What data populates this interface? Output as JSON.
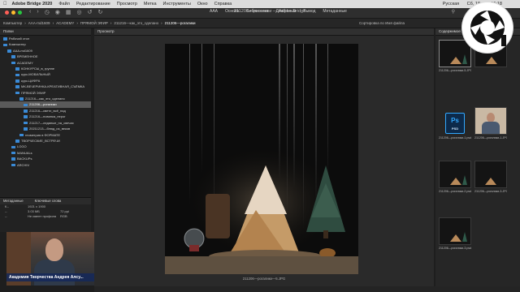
{
  "menubar": {
    "app": "Adobe Bridge 2020",
    "items": [
      "Файл",
      "Редактирование",
      "Просмотр",
      "Метка",
      "Инструменты",
      "Окно",
      "Справка"
    ],
    "clock": "Сб, 18 дек. 16:18",
    "keyboard": "Русская"
  },
  "window": {
    "title": "211206—рогалики — Adobe Bridge",
    "workspaces": [
      "AAA",
      "Основн",
      "Библиотеки",
      "Диафильм",
      "Вывод",
      "Метаданные"
    ]
  },
  "path": {
    "crumbs": [
      "Компьютер",
      "AAA-md1609",
      "ACADEMY",
      "ПРЯМОЙ ЭФИР",
      "211216—как_это_сделано",
      "211206—рогалики"
    ],
    "sort": "Сортировка по Имя файла"
  },
  "folders": {
    "title": "Папки",
    "items": [
      {
        "label": "Рабочий стол",
        "depth": 0
      },
      {
        "label": "Компьютер",
        "depth": 0
      },
      {
        "label": "AAA-md1609",
        "depth": 1
      },
      {
        "label": "ВРЕМЕННОЕ",
        "depth": 2
      },
      {
        "label": "ACADEMY",
        "depth": 2
      },
      {
        "label": "КОНКУРСЫ_в_группе",
        "depth": 3
      },
      {
        "label": "курс-МОБИЛЬНЫЙ",
        "depth": 3
      },
      {
        "label": "курс-ЦИФРА",
        "depth": 3
      },
      {
        "label": "МК-ВЕЧЕРИНКА-КРЕАТИВНАЯ_СЪЁМКА",
        "depth": 3
      },
      {
        "label": "ПРЯМОЙ ЭФИР",
        "depth": 3
      },
      {
        "label": "211216—как_это_сделано",
        "depth": 4
      },
      {
        "label": "211206—рогалики",
        "depth": 5,
        "selected": true
      },
      {
        "label": "211216—светл_всё_над",
        "depth": 5
      },
      {
        "label": "211216—новинка_перог",
        "depth": 5
      },
      {
        "label": "211217—ледяные_на_свечах",
        "depth": 5
      },
      {
        "label": "20211213—блюд_из_веков",
        "depth": 5
      },
      {
        "label": "геометрия в ФОРМАТЕ",
        "depth": 4
      },
      {
        "label": "ТВОРЧЕСКИЕ_ВСТРЕЧИ",
        "depth": 3
      },
      {
        "label": "LOGO",
        "depth": 2
      },
      {
        "label": "MANUALs",
        "depth": 2
      },
      {
        "label": "BACKUPs",
        "depth": 2
      },
      {
        "label": "ARCHIV",
        "depth": 2
      }
    ]
  },
  "metadata": {
    "tabs": [
      "Метаданные",
      "Ключевые слова"
    ],
    "rows": [
      {
        "k": "f/--",
        "v": "1921 x 1900"
      },
      {
        "k": "--",
        "v": "3.03 МБ",
        "v2": "72 ppi"
      },
      {
        "k": "--",
        "v": "Не имеет профиля",
        "v2": "RGB"
      }
    ]
  },
  "webcam": {
    "caption": "Академия Творчества Андрея Алсу..."
  },
  "preview": {
    "title": "Просмотр",
    "filename": "211206—рогалики—5.JPG"
  },
  "content": {
    "title": "Содержимое",
    "thumbs": [
      {
        "label": "211206—рогалики-5.JPG",
        "kind": "photo",
        "selected": true
      },
      {
        "label": "",
        "kind": "photo"
      },
      {
        "label": "211206—рогалики-1.psd",
        "kind": "psd"
      },
      {
        "label": "211206—рогалики-1.JPG",
        "kind": "person"
      },
      {
        "label": "211206—рогалики-2.psd",
        "kind": "photo"
      },
      {
        "label": "211206—рогалики-3.JPG",
        "kind": "photo"
      },
      {
        "label": "211206—рогалики-3.psd",
        "kind": "photo"
      }
    ],
    "psd_text": "Ps",
    "psd_sub": "PSD"
  },
  "colors": {
    "accent": "#3a8ad6",
    "ps": "#31a8ff"
  }
}
